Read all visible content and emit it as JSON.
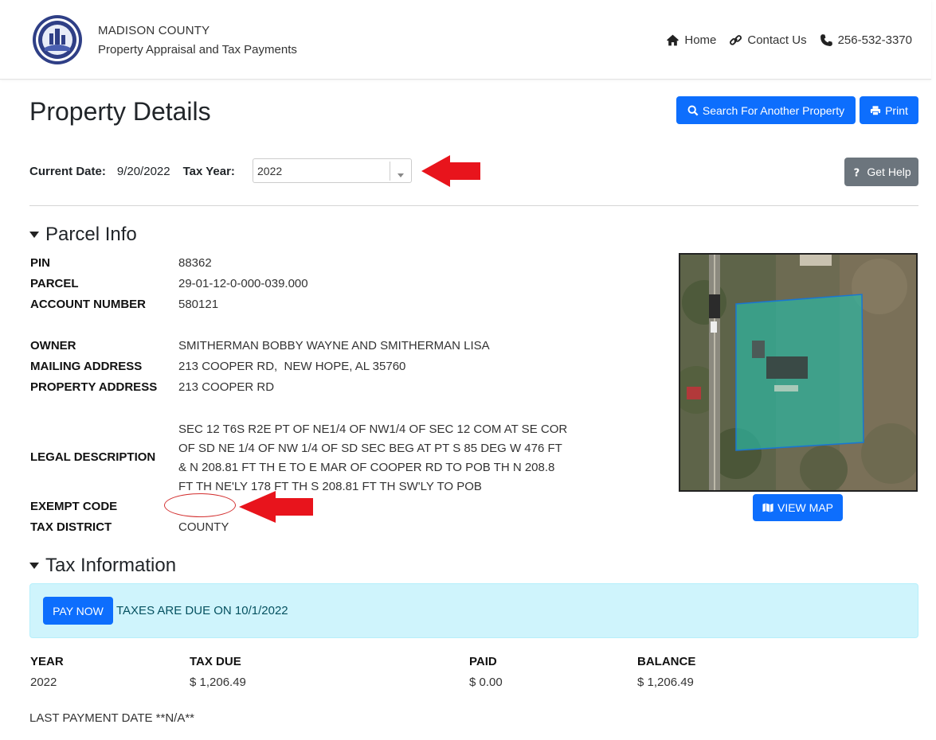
{
  "header": {
    "org_line1": "MADISON COUNTY",
    "org_line2": "Property Appraisal and Tax Payments",
    "nav": {
      "home": "Home",
      "contact": "Contact Us",
      "phone": "256-532-3370"
    }
  },
  "page": {
    "title": "Property Details",
    "search_button": "Search For Another Property",
    "print_button": "Print",
    "current_date_label": "Current Date:",
    "current_date": "9/20/2022",
    "tax_year_label": "Tax Year:",
    "tax_year_value": "2022",
    "help_button": "Get Help"
  },
  "parcel": {
    "section_title": "Parcel Info",
    "pin_label": "PIN",
    "pin": "88362",
    "parcel_label": "PARCEL",
    "parcel": "29-01-12-0-000-039.000",
    "account_label": "ACCOUNT NUMBER",
    "account": "580121",
    "owner_label": "OWNER",
    "owner": "SMITHERMAN BOBBY WAYNE AND SMITHERMAN LISA",
    "mailing_label": "MAILING ADDRESS",
    "mailing": "213 COOPER RD,  NEW HOPE, AL 35760",
    "property_label": "PROPERTY ADDRESS",
    "property": "213 COOPER RD",
    "legal_label": "LEGAL DESCRIPTION",
    "legal": "SEC 12 T6S R2E PT OF NE1/4 OF NW1/4 OF SEC 12 COM AT SE COR OF SD NE 1/4 OF NW 1/4 OF SD SEC BEG AT PT S 85 DEG W 476 FT & N 208.81 FT TH E TO E MAR OF COOPER RD TO POB TH N 208.8 FT TH NE'LY 178 FT TH S 208.81 FT TH SW'LY TO POB",
    "exempt_label": "EXEMPT CODE",
    "exempt": "",
    "district_label": "TAX DISTRICT",
    "district": "COUNTY",
    "view_map_button": "VIEW MAP"
  },
  "tax": {
    "section_title": "Tax Information",
    "pay_button": "PAY NOW",
    "due_notice": "TAXES ARE DUE ON 10/1/2022",
    "headers": {
      "year": "YEAR",
      "tax_due": "TAX DUE",
      "paid": "PAID",
      "balance": "BALANCE"
    },
    "row": {
      "year": "2022",
      "tax_due": "$ 1,206.49",
      "paid": "$ 0.00",
      "balance": "$ 1,206.49"
    },
    "last_payment": "LAST PAYMENT DATE **N/A**"
  }
}
